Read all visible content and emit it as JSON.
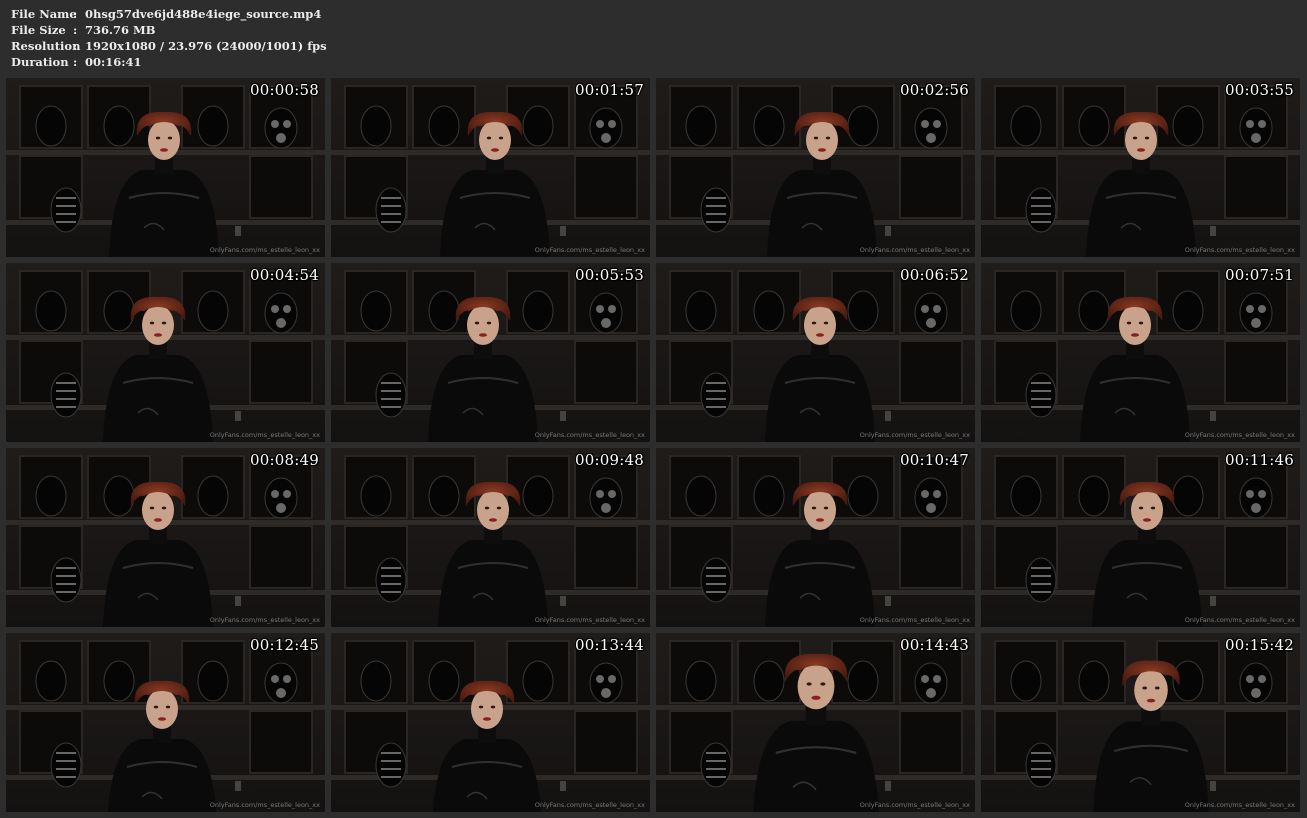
{
  "file_info": {
    "name_label": "File Name",
    "name_value": "0hsg57dve6jd488e4iege_source.mp4",
    "size_label": "File Size",
    "size_value": "736.76 MB",
    "resolution_label": "Resolution",
    "resolution_value": "1920x1080 / 23.976 (24000/1001) fps",
    "duration_label": "Duration",
    "duration_value": "00:16:41",
    "separator": ":"
  },
  "watermark": "OnlyFans.com/ms_estelle_leon_xx",
  "thumbnails": [
    {
      "timestamp": "00:00:58"
    },
    {
      "timestamp": "00:01:57"
    },
    {
      "timestamp": "00:02:56"
    },
    {
      "timestamp": "00:03:55"
    },
    {
      "timestamp": "00:04:54"
    },
    {
      "timestamp": "00:05:53"
    },
    {
      "timestamp": "00:06:52"
    },
    {
      "timestamp": "00:07:51"
    },
    {
      "timestamp": "00:08:49"
    },
    {
      "timestamp": "00:09:48"
    },
    {
      "timestamp": "00:10:47"
    },
    {
      "timestamp": "00:11:46"
    },
    {
      "timestamp": "00:12:45"
    },
    {
      "timestamp": "00:13:44"
    },
    {
      "timestamp": "00:14:43"
    },
    {
      "timestamp": "00:15:42"
    }
  ]
}
